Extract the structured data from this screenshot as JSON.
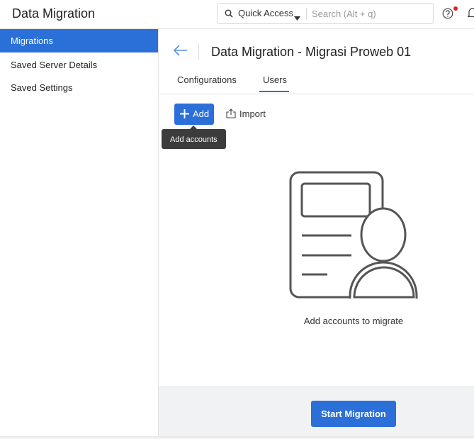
{
  "header": {
    "app_title": "Data Migration",
    "quick_access_label": "Quick Access",
    "search_placeholder": "Search (Alt + q)",
    "search_value": "",
    "notification_dot_color": "#e02424"
  },
  "sidebar": {
    "items": [
      {
        "label": "Migrations",
        "active": true
      },
      {
        "label": "Saved Server Details",
        "active": false
      },
      {
        "label": "Saved Settings",
        "active": false
      }
    ]
  },
  "main": {
    "page_title": "Data Migration - Migrasi Proweb 01",
    "tabs": [
      {
        "label": "Configurations",
        "active": false
      },
      {
        "label": "Users",
        "active": true
      }
    ],
    "add_label": "Add",
    "import_label": "Import",
    "tooltip": "Add accounts",
    "empty_text": "Add accounts to migrate",
    "start_label": "Start Migration"
  },
  "colors": {
    "accent": "#2b6fd9",
    "tooltip_bg": "#3c3c3c",
    "footer_bg": "#f1f2f4"
  },
  "icons": [
    "search-icon",
    "caret-down-icon",
    "help-icon",
    "bell-icon",
    "back-arrow-icon",
    "plus-icon",
    "import-icon",
    "empty-accounts-illustration"
  ]
}
